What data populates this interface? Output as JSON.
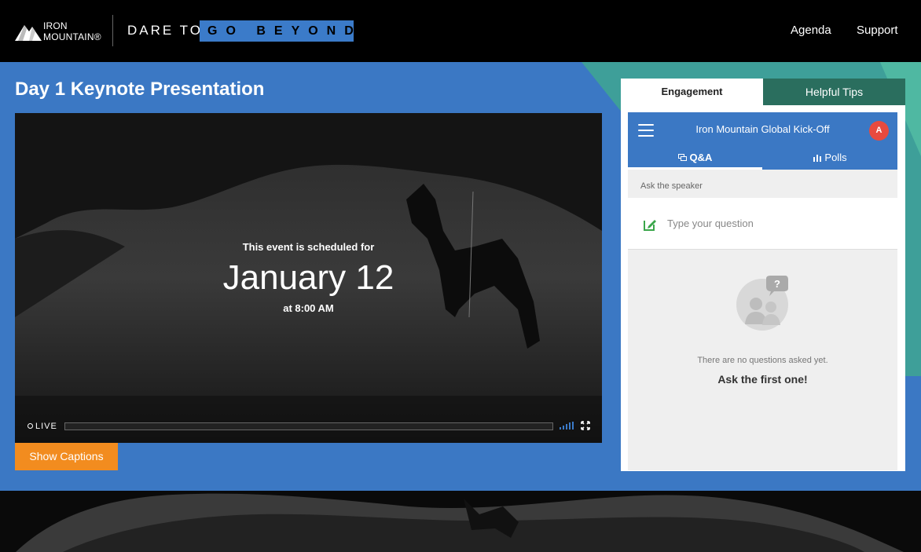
{
  "header": {
    "logo_line1": "IRON",
    "logo_line2": "MOUNTAIN®",
    "tagline_dare": "DARE TO",
    "tagline_highlight": "GO BEYOND",
    "nav": [
      "Agenda",
      "Support"
    ]
  },
  "main": {
    "title": "Day 1 Keynote Presentation",
    "video": {
      "schedule_lead": "This event is scheduled for",
      "schedule_date": "January 12",
      "schedule_time": "at 8:00 AM",
      "live_label": "LIVE"
    },
    "captions_button": "Show Captions"
  },
  "panel": {
    "tabs": [
      "Engagement",
      "Helpful Tips"
    ],
    "widget": {
      "title": "Iron Mountain Global Kick-Off",
      "avatar_initial": "A",
      "tabs": [
        "Q&A",
        "Polls"
      ],
      "ask_label": "Ask the speaker",
      "ask_placeholder": "Type your question",
      "empty_text": "There are no questions asked yet.",
      "empty_cta": "Ask the first one!"
    }
  },
  "colors": {
    "stage_blue": "#3b78c4",
    "teal": "#2a6e5e",
    "accent_orange": "#f28c1f",
    "avatar_red": "#e84a3f",
    "edit_green": "#3aa64a"
  },
  "icons": [
    "mountain-logo-icon",
    "hamburger-icon",
    "chat-icon",
    "bar-chart-icon",
    "edit-icon",
    "question-people-icon",
    "signal-icon",
    "fullscreen-icon"
  ]
}
